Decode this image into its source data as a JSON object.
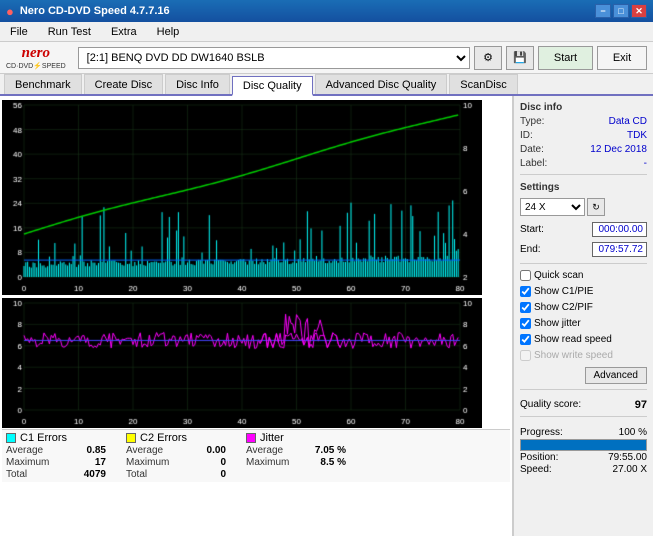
{
  "titlebar": {
    "title": "Nero CD-DVD Speed 4.7.7.16",
    "min_btn": "−",
    "max_btn": "□",
    "close_btn": "✕"
  },
  "menubar": {
    "items": [
      "File",
      "Run Test",
      "Extra",
      "Help"
    ]
  },
  "toolbar": {
    "logo_top": "nero",
    "logo_bottom": "CD·DVD⚡SPEED",
    "drive_label": "[2:1]  BENQ DVD DD DW1640 BSLB",
    "start_label": "Start",
    "eject_label": "Exit"
  },
  "tabs": [
    {
      "label": "Benchmark"
    },
    {
      "label": "Create Disc"
    },
    {
      "label": "Disc Info"
    },
    {
      "label": "Disc Quality",
      "active": true
    },
    {
      "label": "Advanced Disc Quality"
    },
    {
      "label": "ScanDisc"
    }
  ],
  "disc_info": {
    "title": "Disc info",
    "type_label": "Type:",
    "type_val": "Data CD",
    "id_label": "ID:",
    "id_val": "TDK",
    "date_label": "Date:",
    "date_val": "12 Dec 2018",
    "label_label": "Label:",
    "label_val": "-"
  },
  "settings": {
    "title": "Settings",
    "speed_label": "24 X",
    "start_label": "Start:",
    "start_val": "000:00.00",
    "end_label": "End:",
    "end_val": "079:57.72"
  },
  "checkboxes": [
    {
      "label": "Quick scan",
      "checked": false
    },
    {
      "label": "Show C1/PIE",
      "checked": true
    },
    {
      "label": "Show C2/PIF",
      "checked": true
    },
    {
      "label": "Show jitter",
      "checked": true
    },
    {
      "label": "Show read speed",
      "checked": true
    },
    {
      "label": "Show write speed",
      "checked": false,
      "disabled": true
    }
  ],
  "advanced_btn": "Advanced",
  "quality": {
    "label": "Quality score:",
    "val": "97"
  },
  "progress": {
    "label": "Progress:",
    "val": "100 %",
    "position_label": "Position:",
    "position_val": "79:55.00",
    "speed_label": "Speed:",
    "speed_val": "27.00 X"
  },
  "stats": {
    "c1": {
      "label": "C1 Errors",
      "color": "#00ffff",
      "average_label": "Average",
      "average_val": "0.85",
      "maximum_label": "Maximum",
      "maximum_val": "17",
      "total_label": "Total",
      "total_val": "4079"
    },
    "c2": {
      "label": "C2 Errors",
      "color": "#ffff00",
      "average_label": "Average",
      "average_val": "0.00",
      "maximum_label": "Maximum",
      "maximum_val": "0",
      "total_label": "Total",
      "total_val": "0"
    },
    "jitter": {
      "label": "Jitter",
      "color": "#ff00ff",
      "average_label": "Average",
      "average_val": "7.05 %",
      "maximum_label": "Maximum",
      "maximum_val": "8.5 %"
    }
  },
  "chart1": {
    "y_max": 56,
    "y_labels": [
      "56",
      "48",
      "40",
      "32",
      "24",
      "16",
      "8",
      "0"
    ],
    "x_labels": [
      "0",
      "10",
      "20",
      "30",
      "40",
      "50",
      "60",
      "70",
      "80"
    ]
  },
  "chart2": {
    "y_max": 10,
    "y_labels": [
      "10",
      "8",
      "6",
      "4",
      "2",
      "0"
    ],
    "x_labels": [
      "0",
      "10",
      "20",
      "30",
      "40",
      "50",
      "60",
      "70",
      "80"
    ]
  }
}
